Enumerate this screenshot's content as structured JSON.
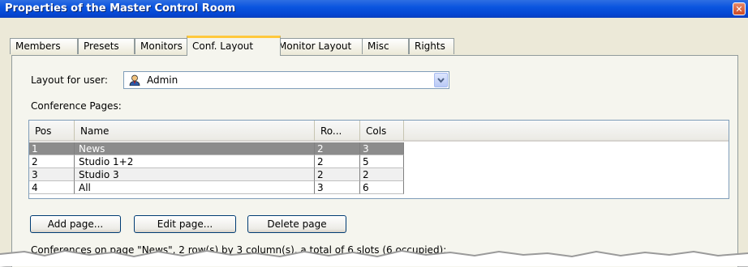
{
  "window": {
    "title": "Properties of the Master Control Room",
    "close_glyph": "✕"
  },
  "tabs": [
    {
      "label": "Members"
    },
    {
      "label": "Presets"
    },
    {
      "label": "Monitors"
    },
    {
      "label": "Conf. Layout"
    },
    {
      "label": "Monitor Layout"
    },
    {
      "label": "Misc"
    },
    {
      "label": "Rights"
    }
  ],
  "active_tab": "Conf. Layout",
  "layout_user": {
    "label": "Layout for user:",
    "value": "Admin",
    "icon": "user-icon"
  },
  "conference_pages": {
    "label": "Conference Pages:",
    "columns": [
      "Pos",
      "Name",
      "Ro...",
      "Cols"
    ],
    "rows": [
      {
        "pos": "1",
        "name": "News",
        "rows": "2",
        "cols": "3",
        "selected": true
      },
      {
        "pos": "2",
        "name": "Studio 1+2",
        "rows": "2",
        "cols": "5",
        "selected": false
      },
      {
        "pos": "3",
        "name": "Studio 3",
        "rows": "2",
        "cols": "2",
        "selected": false
      },
      {
        "pos": "4",
        "name": "All",
        "rows": "3",
        "cols": "6",
        "selected": false
      }
    ]
  },
  "buttons": {
    "add_page": "Add page...",
    "edit_page": "Edit page...",
    "delete_page": "Delete page"
  },
  "summary_text": "Conferences on page \"News\", 2 row(s) by 3 column(s), a total of 6 slots (6 occupied):",
  "colors": {
    "title_bar": "#0a55df",
    "active_tab_accent": "#ffc83c",
    "selected_row": "#8c8c8c"
  }
}
